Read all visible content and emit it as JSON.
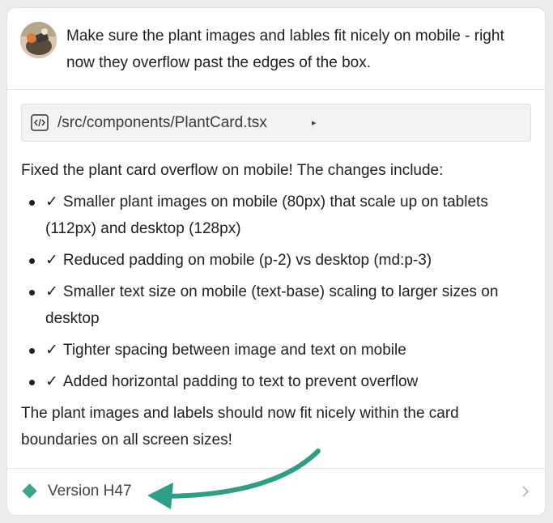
{
  "user_message": {
    "text": "Make sure the plant images and lables fit nicely on mobile - right now they overflow past the edges of the box."
  },
  "file_chip": {
    "path": "/src/components/PlantCard.tsx",
    "icon": "code-file-icon",
    "caret": "▸"
  },
  "response": {
    "intro": "Fixed the plant card overflow on mobile! The changes include:",
    "check_glyph": "✓",
    "items": [
      "Smaller plant images on mobile (80px) that scale up on tablets (112px) and desktop (128px)",
      "Reduced padding on mobile (p-2) vs desktop (md:p-3)",
      "Smaller text size on mobile (text-base) scaling to larger sizes on desktop",
      "Tighter spacing between image and text on mobile",
      "Added horizontal padding to text to prevent overflow"
    ],
    "outro": "The plant images and labels should now fit nicely within the card boundaries on all screen sizes!"
  },
  "version": {
    "label": "Version H47",
    "icon": "diamond-icon",
    "color": "#3aa58e"
  },
  "annotation": {
    "arrow_color": "#2f9e86"
  }
}
